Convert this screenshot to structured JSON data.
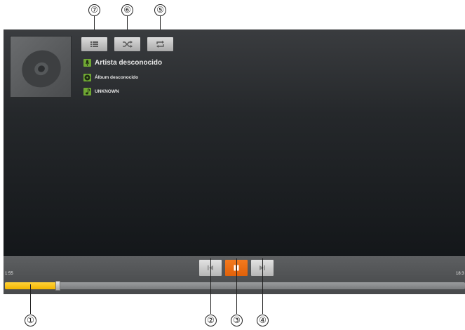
{
  "track": {
    "artist": "Artista desconocido",
    "album": "Álbum desconocido",
    "title": "UNKNOWN"
  },
  "playback": {
    "elapsed": "1:55",
    "duration": "18:3",
    "progress_fraction": 0.115,
    "state": "playing"
  },
  "icons": {
    "playlist": "list-icon",
    "shuffle": "shuffle-icon",
    "repeat": "repeat-icon",
    "previous": "skip-previous-icon",
    "pause": "pause-icon",
    "next": "skip-next-icon",
    "album_art": "cd-icon",
    "artist": "microphone-icon",
    "album": "album-icon",
    "song": "music-note-icon"
  },
  "callouts": {
    "seek_bar": "①",
    "previous": "②",
    "pause": "③",
    "next": "④",
    "repeat": "⑤",
    "shuffle": "⑥",
    "playlist": "⑦"
  },
  "colors": {
    "accent_orange": "#f0701a",
    "progress_yellow": "#f8c21a",
    "meta_icon_green": "#6fa833"
  }
}
